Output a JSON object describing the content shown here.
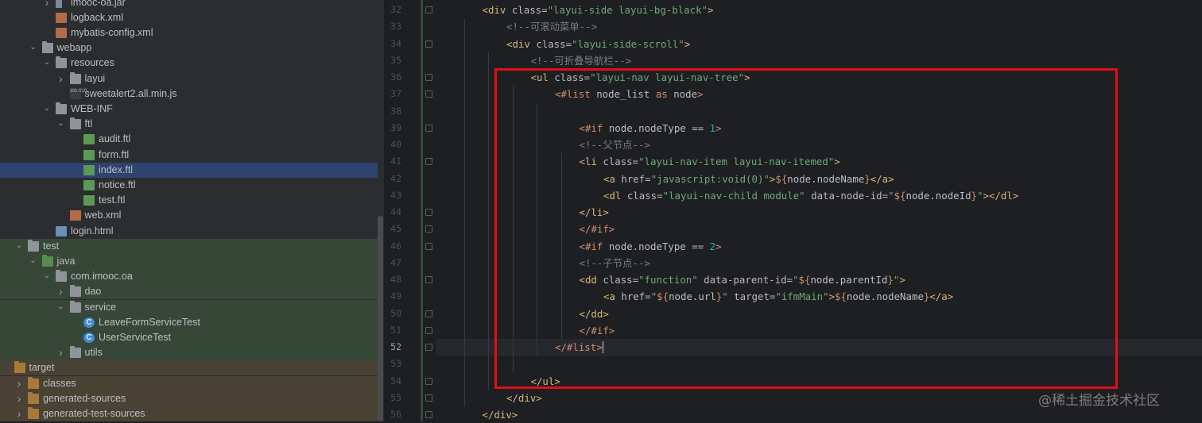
{
  "project_tree": [
    {
      "label": "imooc-oa.jar",
      "icon": "jar-icon",
      "depth": 2,
      "arrow": "right",
      "bg": ""
    },
    {
      "label": "logback.xml",
      "icon": "xml-file-icon",
      "depth": 2,
      "arrow": "",
      "bg": ""
    },
    {
      "label": "mybatis-config.xml",
      "icon": "xml-file-icon",
      "depth": 2,
      "arrow": "",
      "bg": ""
    },
    {
      "label": "webapp",
      "icon": "folder-icon",
      "depth": 1,
      "arrow": "down",
      "bg": ""
    },
    {
      "label": "resources",
      "icon": "folder-icon",
      "depth": 2,
      "arrow": "down",
      "bg": ""
    },
    {
      "label": "layui",
      "icon": "folder-icon",
      "depth": 3,
      "arrow": "right",
      "bg": ""
    },
    {
      "label": "sweetalert2.all.min.js",
      "icon": "js-file-icon",
      "depth": 3,
      "arrow": "",
      "bg": ""
    },
    {
      "label": "WEB-INF",
      "icon": "folder-icon",
      "depth": 2,
      "arrow": "down",
      "bg": ""
    },
    {
      "label": "ftl",
      "icon": "folder-icon",
      "depth": 3,
      "arrow": "down",
      "bg": ""
    },
    {
      "label": "audit.ftl",
      "icon": "ftl-file-icon",
      "depth": 4,
      "arrow": "",
      "bg": ""
    },
    {
      "label": "form.ftl",
      "icon": "ftl-file-icon",
      "depth": 4,
      "arrow": "",
      "bg": ""
    },
    {
      "label": "index.ftl",
      "icon": "ftl-file-icon",
      "depth": 4,
      "arrow": "",
      "bg": "selected"
    },
    {
      "label": "notice.ftl",
      "icon": "ftl-file-icon",
      "depth": 4,
      "arrow": "",
      "bg": ""
    },
    {
      "label": "test.ftl",
      "icon": "ftl-file-icon",
      "depth": 4,
      "arrow": "",
      "bg": ""
    },
    {
      "label": "web.xml",
      "icon": "xml-file-icon",
      "depth": 3,
      "arrow": "",
      "bg": ""
    },
    {
      "label": "login.html",
      "icon": "html-file-icon",
      "depth": 2,
      "arrow": "",
      "bg": ""
    },
    {
      "label": "test",
      "icon": "folder-icon",
      "depth": 0,
      "arrow": "down",
      "bg": "test-bg"
    },
    {
      "label": "java",
      "icon": "folder-green-icon",
      "depth": 1,
      "arrow": "down",
      "bg": "test-bg"
    },
    {
      "label": "com.imooc.oa",
      "icon": "package-icon",
      "depth": 2,
      "arrow": "down",
      "bg": "test-bg"
    },
    {
      "label": "dao",
      "icon": "package-icon",
      "depth": 3,
      "arrow": "right",
      "bg": "test-bg"
    },
    {
      "label": "service",
      "icon": "package-icon",
      "depth": 3,
      "arrow": "down",
      "bg": "test-bg"
    },
    {
      "label": "LeaveFormServiceTest",
      "icon": "class-icon",
      "depth": 4,
      "arrow": "",
      "bg": "test-bg"
    },
    {
      "label": "UserServiceTest",
      "icon": "class-icon",
      "depth": 4,
      "arrow": "",
      "bg": "test-bg"
    },
    {
      "label": "utils",
      "icon": "package-icon",
      "depth": 3,
      "arrow": "right",
      "bg": "test-bg"
    },
    {
      "label": "target",
      "icon": "folder-orange-icon",
      "depth": -1,
      "arrow": "",
      "bg": "target-bg"
    },
    {
      "label": "classes",
      "icon": "folder-orange-icon",
      "depth": 0,
      "arrow": "right",
      "bg": "target-bg"
    },
    {
      "label": "generated-sources",
      "icon": "folder-orange-icon",
      "depth": 0,
      "arrow": "right",
      "bg": "target-bg"
    },
    {
      "label": "generated-test-sources",
      "icon": "folder-orange-icon",
      "depth": 0,
      "arrow": "right",
      "bg": "target-bg"
    }
  ],
  "editor": {
    "current_line": "52",
    "lines": [
      {
        "num": "32",
        "indent": 1,
        "fold": true,
        "tokens": [
          [
            "t-tag",
            "<div "
          ],
          [
            "t-attr",
            "class="
          ],
          [
            "t-str",
            "\"layui-side layui-bg-black\""
          ],
          [
            "t-tag",
            ">"
          ]
        ]
      },
      {
        "num": "33",
        "indent": 2,
        "fold": false,
        "tokens": [
          [
            "t-com",
            "<!--可滚动菜单-->"
          ]
        ]
      },
      {
        "num": "34",
        "indent": 2,
        "fold": true,
        "tokens": [
          [
            "t-tag",
            "<div "
          ],
          [
            "t-attr",
            "class="
          ],
          [
            "t-str",
            "\"layui-side-scroll\""
          ],
          [
            "t-tag",
            ">"
          ]
        ]
      },
      {
        "num": "35",
        "indent": 3,
        "fold": false,
        "tokens": [
          [
            "t-com",
            "<!--可折叠导航栏-->"
          ]
        ]
      },
      {
        "num": "36",
        "indent": 3,
        "fold": true,
        "tokens": [
          [
            "t-tag",
            "<ul "
          ],
          [
            "t-attr",
            "class="
          ],
          [
            "t-str",
            "\"layui-nav layui-nav-tree\""
          ],
          [
            "t-tag",
            ">"
          ]
        ]
      },
      {
        "num": "37",
        "indent": 4,
        "fold": true,
        "tokens": [
          [
            "t-ftl",
            "<#list "
          ],
          [
            "t-var",
            "node_list"
          ],
          [
            "t-ftl",
            " as "
          ],
          [
            "t-var",
            "node"
          ],
          [
            "t-ftl",
            ">"
          ]
        ]
      },
      {
        "num": "38",
        "indent": 0,
        "fold": false,
        "tokens": []
      },
      {
        "num": "39",
        "indent": 5,
        "fold": true,
        "tokens": [
          [
            "t-ftl",
            "<#if "
          ],
          [
            "t-var",
            "node.nodeType"
          ],
          [
            "t-var",
            " == "
          ],
          [
            "t-num",
            "1"
          ],
          [
            "t-ftl",
            ">"
          ]
        ]
      },
      {
        "num": "40",
        "indent": 5,
        "fold": false,
        "tokens": [
          [
            "t-com",
            "<!--父节点-->"
          ]
        ]
      },
      {
        "num": "41",
        "indent": 5,
        "fold": true,
        "tokens": [
          [
            "t-tag",
            "<li "
          ],
          [
            "t-attr",
            "class="
          ],
          [
            "t-str",
            "\"layui-nav-item layui-nav-itemed\""
          ],
          [
            "t-tag",
            ">"
          ]
        ]
      },
      {
        "num": "42",
        "indent": 6,
        "fold": false,
        "tokens": [
          [
            "t-tag",
            "<a "
          ],
          [
            "t-attr",
            "href="
          ],
          [
            "t-str",
            "\"javascript:void(0)\""
          ],
          [
            "t-tag",
            ">"
          ],
          [
            "t-interp",
            "${"
          ],
          [
            "t-var",
            "node.nodeName"
          ],
          [
            "t-interp",
            "}"
          ],
          [
            "t-tag",
            "</a>"
          ]
        ]
      },
      {
        "num": "43",
        "indent": 6,
        "fold": false,
        "tokens": [
          [
            "t-tag",
            "<dl "
          ],
          [
            "t-attr",
            "class="
          ],
          [
            "t-str",
            "\"layui-nav-child module\" "
          ],
          [
            "t-attr",
            "data-node-id="
          ],
          [
            "t-str",
            "\""
          ],
          [
            "t-interp",
            "${"
          ],
          [
            "t-var",
            "node.nodeId"
          ],
          [
            "t-interp",
            "}"
          ],
          [
            "t-str",
            "\""
          ],
          [
            "t-tag",
            "></dl>"
          ]
        ]
      },
      {
        "num": "44",
        "indent": 5,
        "fold": true,
        "tokens": [
          [
            "t-tag",
            "</li>"
          ]
        ]
      },
      {
        "num": "45",
        "indent": 5,
        "fold": true,
        "tokens": [
          [
            "t-ftl",
            "</#if>"
          ]
        ]
      },
      {
        "num": "46",
        "indent": 5,
        "fold": true,
        "tokens": [
          [
            "t-ftl",
            "<#if "
          ],
          [
            "t-var",
            "node.nodeType"
          ],
          [
            "t-var",
            " == "
          ],
          [
            "t-num",
            "2"
          ],
          [
            "t-ftl",
            ">"
          ]
        ]
      },
      {
        "num": "47",
        "indent": 5,
        "fold": false,
        "tokens": [
          [
            "t-com",
            "<!--子节点-->"
          ]
        ]
      },
      {
        "num": "48",
        "indent": 5,
        "fold": true,
        "tokens": [
          [
            "t-tag",
            "<dd "
          ],
          [
            "t-attr",
            "class="
          ],
          [
            "t-str",
            "\"function\" "
          ],
          [
            "t-attr",
            "data-parent-id="
          ],
          [
            "t-str",
            "\""
          ],
          [
            "t-interp",
            "${"
          ],
          [
            "t-var",
            "node.parentId"
          ],
          [
            "t-interp",
            "}"
          ],
          [
            "t-str",
            "\""
          ],
          [
            "t-tag",
            ">"
          ]
        ]
      },
      {
        "num": "49",
        "indent": 6,
        "fold": false,
        "tokens": [
          [
            "t-tag",
            "<a "
          ],
          [
            "t-attr",
            "href="
          ],
          [
            "t-str",
            "\""
          ],
          [
            "t-interp",
            "${"
          ],
          [
            "t-var",
            "node.url"
          ],
          [
            "t-interp",
            "}"
          ],
          [
            "t-str",
            "\" "
          ],
          [
            "t-attr",
            "target="
          ],
          [
            "t-str",
            "\"ifmMain\""
          ],
          [
            "t-tag",
            ">"
          ],
          [
            "t-interp",
            "${"
          ],
          [
            "t-var",
            "node.nodeName"
          ],
          [
            "t-interp",
            "}"
          ],
          [
            "t-tag",
            "</a>"
          ]
        ]
      },
      {
        "num": "50",
        "indent": 5,
        "fold": true,
        "tokens": [
          [
            "t-tag",
            "</dd>"
          ]
        ]
      },
      {
        "num": "51",
        "indent": 5,
        "fold": true,
        "tokens": [
          [
            "t-ftl",
            "</#if>"
          ]
        ]
      },
      {
        "num": "52",
        "indent": 4,
        "fold": true,
        "tokens": [
          [
            "t-ftl",
            "</#list>"
          ]
        ]
      },
      {
        "num": "53",
        "indent": 0,
        "fold": false,
        "tokens": []
      },
      {
        "num": "54",
        "indent": 3,
        "fold": true,
        "tokens": [
          [
            "t-tag",
            "</ul>"
          ]
        ]
      },
      {
        "num": "55",
        "indent": 2,
        "fold": true,
        "tokens": [
          [
            "t-tag",
            "</div>"
          ]
        ]
      },
      {
        "num": "56",
        "indent": 1,
        "fold": true,
        "tokens": [
          [
            "t-tag",
            "</div>"
          ]
        ]
      }
    ]
  },
  "watermark": "@稀土掘金技术社区",
  "colors": {
    "highlight_box": "#e10e16",
    "selection": "#2e436e"
  }
}
